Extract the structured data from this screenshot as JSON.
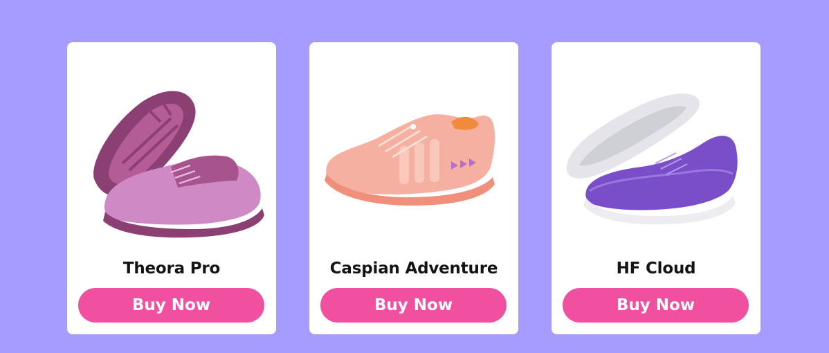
{
  "colors": {
    "background": "#a69bff",
    "card": "#ffffff",
    "button": "#f14fa0",
    "button_text": "#ffffff",
    "title_text": "#141414"
  },
  "products": [
    {
      "name": "Theora Pro",
      "button_label": "Buy Now",
      "image_icon": "mauve-barefoot-shoe-pair-icon",
      "shoe_color": "#c97fc1"
    },
    {
      "name": "Caspian Adventure",
      "button_label": "Buy Now",
      "image_icon": "peach-water-shoe-icon",
      "shoe_color": "#f4a99a"
    },
    {
      "name": "HF Cloud",
      "button_label": "Buy Now",
      "image_icon": "purple-knit-shoe-pair-icon",
      "shoe_color": "#7b4fc8"
    }
  ]
}
